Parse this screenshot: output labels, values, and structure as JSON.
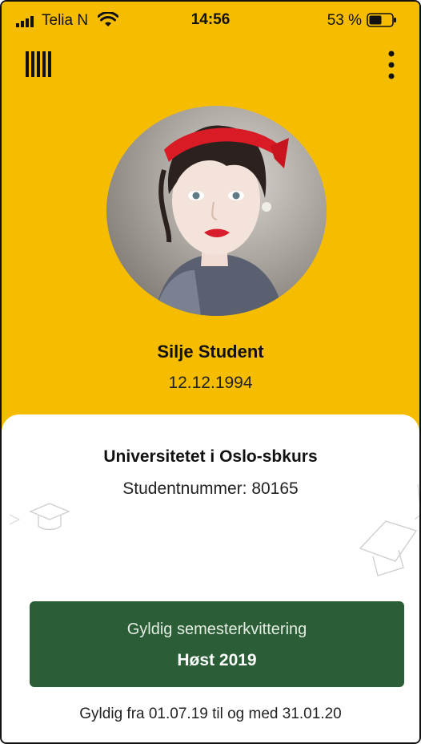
{
  "status_bar": {
    "carrier": "Telia N",
    "time": "14:56",
    "battery_percent": "53 %",
    "battery_level": 0.53
  },
  "toolbar": {
    "barcode_icon": "barcode-icon",
    "menu_icon": "more-vertical-icon"
  },
  "profile": {
    "name": "Silje Student",
    "birth_date": "12.12.1994"
  },
  "card": {
    "institution": "Universitetet i Oslo-sbkurs",
    "student_number": "Studentnummer: 80165",
    "receipt": {
      "title": "Gyldig semesterkvittering",
      "term": "Høst 2019"
    },
    "validity": "Gyldig fra 01.07.19 til og med 31.01.20"
  },
  "colors": {
    "header": "#f6bd00",
    "valid_box": "#2b5e36",
    "card": "#ffffff"
  }
}
